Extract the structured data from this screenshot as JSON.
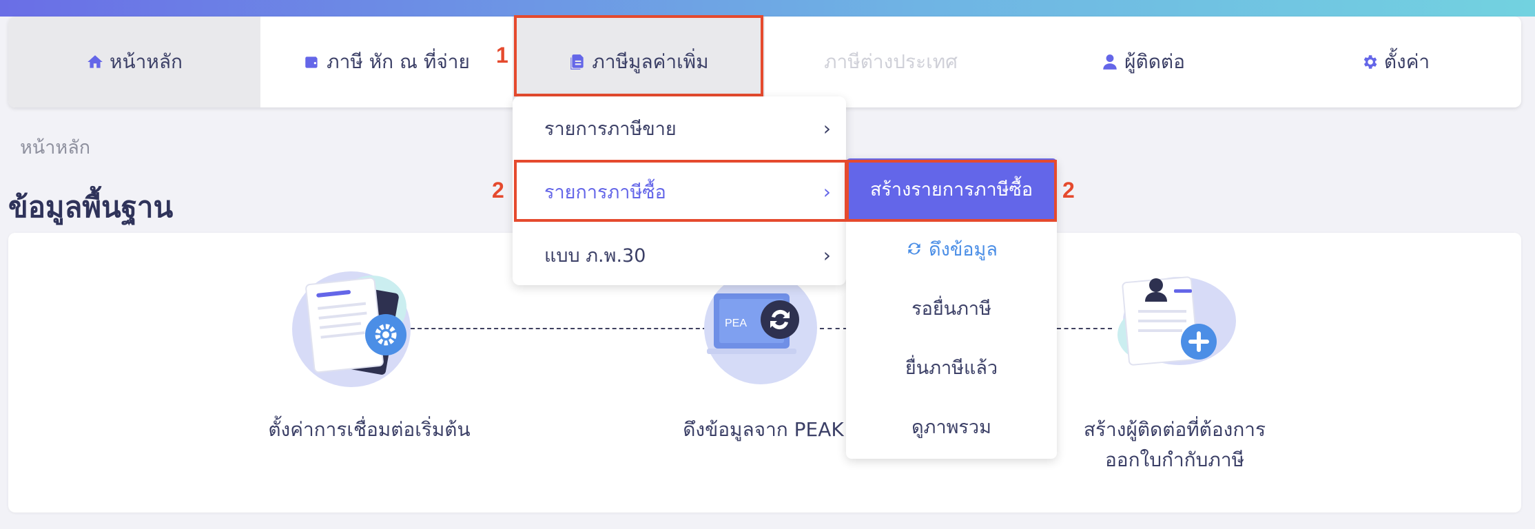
{
  "colors": {
    "accent": "#6366e9",
    "highlight": "#e54a2e",
    "link": "#4b8ee6"
  },
  "nav": {
    "items": [
      {
        "label": "หน้าหลัก",
        "icon": "home-icon"
      },
      {
        "label": "ภาษี หัก ณ ที่จ่าย",
        "icon": "wallet-icon"
      },
      {
        "label": "ภาษีมูลค่าเพิ่ม",
        "icon": "document-icon"
      },
      {
        "label": "ภาษีต่างประเทศ",
        "icon": ""
      },
      {
        "label": "ผู้ติดต่อ",
        "icon": "user-icon"
      },
      {
        "label": "ตั้งค่า",
        "icon": "gear-icon"
      }
    ]
  },
  "annotations": {
    "step1": "1",
    "step2": "2"
  },
  "breadcrumb": "หน้าหลัก",
  "page_title": "ข้อมูลพื้นฐาน",
  "dropdown": {
    "items": [
      {
        "label": "รายการภาษีขาย",
        "chevron": "›"
      },
      {
        "label": "รายการภาษีซื้อ",
        "chevron": "›"
      },
      {
        "label": "แบบ ภ.พ.30",
        "chevron": "›"
      }
    ]
  },
  "submenu": {
    "header": "สร้างรายการภาษีซื้อ",
    "items": [
      {
        "label": "ดึงข้อมูล",
        "icon": "refresh-icon"
      },
      {
        "label": "รอยื่นภาษี"
      },
      {
        "label": "ยื่นภาษีแล้ว"
      },
      {
        "label": "ดูภาพรวม"
      }
    ]
  },
  "steps": {
    "setup": "ตั้งค่าการเชื่อมต่อเริ่มต้น",
    "fetch": "ดึงข้อมูลจาก PEAK",
    "contact_line1": "สร้างผู้ติดต่อที่ต้องการ",
    "contact_line2": "ออกใบกำกับภาษี",
    "peak_logo": "PEA"
  }
}
